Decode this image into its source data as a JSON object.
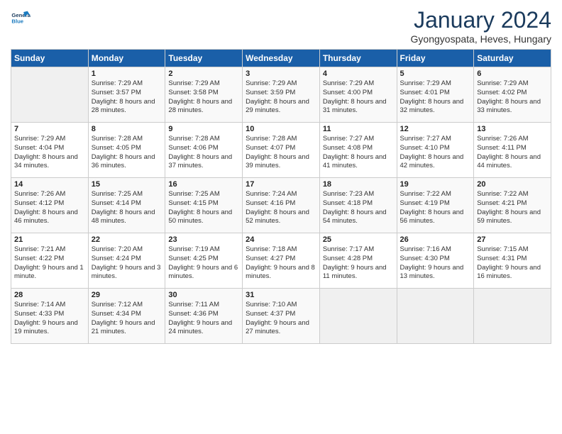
{
  "header": {
    "logo_general": "General",
    "logo_blue": "Blue",
    "month_title": "January 2024",
    "subtitle": "Gyongyospata, Heves, Hungary"
  },
  "days_of_week": [
    "Sunday",
    "Monday",
    "Tuesday",
    "Wednesday",
    "Thursday",
    "Friday",
    "Saturday"
  ],
  "weeks": [
    [
      {
        "day": "",
        "sunrise": "",
        "sunset": "",
        "daylight": ""
      },
      {
        "day": "1",
        "sunrise": "Sunrise: 7:29 AM",
        "sunset": "Sunset: 3:57 PM",
        "daylight": "Daylight: 8 hours and 28 minutes."
      },
      {
        "day": "2",
        "sunrise": "Sunrise: 7:29 AM",
        "sunset": "Sunset: 3:58 PM",
        "daylight": "Daylight: 8 hours and 28 minutes."
      },
      {
        "day": "3",
        "sunrise": "Sunrise: 7:29 AM",
        "sunset": "Sunset: 3:59 PM",
        "daylight": "Daylight: 8 hours and 29 minutes."
      },
      {
        "day": "4",
        "sunrise": "Sunrise: 7:29 AM",
        "sunset": "Sunset: 4:00 PM",
        "daylight": "Daylight: 8 hours and 31 minutes."
      },
      {
        "day": "5",
        "sunrise": "Sunrise: 7:29 AM",
        "sunset": "Sunset: 4:01 PM",
        "daylight": "Daylight: 8 hours and 32 minutes."
      },
      {
        "day": "6",
        "sunrise": "Sunrise: 7:29 AM",
        "sunset": "Sunset: 4:02 PM",
        "daylight": "Daylight: 8 hours and 33 minutes."
      }
    ],
    [
      {
        "day": "7",
        "sunrise": "Sunrise: 7:29 AM",
        "sunset": "Sunset: 4:04 PM",
        "daylight": "Daylight: 8 hours and 34 minutes."
      },
      {
        "day": "8",
        "sunrise": "Sunrise: 7:28 AM",
        "sunset": "Sunset: 4:05 PM",
        "daylight": "Daylight: 8 hours and 36 minutes."
      },
      {
        "day": "9",
        "sunrise": "Sunrise: 7:28 AM",
        "sunset": "Sunset: 4:06 PM",
        "daylight": "Daylight: 8 hours and 37 minutes."
      },
      {
        "day": "10",
        "sunrise": "Sunrise: 7:28 AM",
        "sunset": "Sunset: 4:07 PM",
        "daylight": "Daylight: 8 hours and 39 minutes."
      },
      {
        "day": "11",
        "sunrise": "Sunrise: 7:27 AM",
        "sunset": "Sunset: 4:08 PM",
        "daylight": "Daylight: 8 hours and 41 minutes."
      },
      {
        "day": "12",
        "sunrise": "Sunrise: 7:27 AM",
        "sunset": "Sunset: 4:10 PM",
        "daylight": "Daylight: 8 hours and 42 minutes."
      },
      {
        "day": "13",
        "sunrise": "Sunrise: 7:26 AM",
        "sunset": "Sunset: 4:11 PM",
        "daylight": "Daylight: 8 hours and 44 minutes."
      }
    ],
    [
      {
        "day": "14",
        "sunrise": "Sunrise: 7:26 AM",
        "sunset": "Sunset: 4:12 PM",
        "daylight": "Daylight: 8 hours and 46 minutes."
      },
      {
        "day": "15",
        "sunrise": "Sunrise: 7:25 AM",
        "sunset": "Sunset: 4:14 PM",
        "daylight": "Daylight: 8 hours and 48 minutes."
      },
      {
        "day": "16",
        "sunrise": "Sunrise: 7:25 AM",
        "sunset": "Sunset: 4:15 PM",
        "daylight": "Daylight: 8 hours and 50 minutes."
      },
      {
        "day": "17",
        "sunrise": "Sunrise: 7:24 AM",
        "sunset": "Sunset: 4:16 PM",
        "daylight": "Daylight: 8 hours and 52 minutes."
      },
      {
        "day": "18",
        "sunrise": "Sunrise: 7:23 AM",
        "sunset": "Sunset: 4:18 PM",
        "daylight": "Daylight: 8 hours and 54 minutes."
      },
      {
        "day": "19",
        "sunrise": "Sunrise: 7:22 AM",
        "sunset": "Sunset: 4:19 PM",
        "daylight": "Daylight: 8 hours and 56 minutes."
      },
      {
        "day": "20",
        "sunrise": "Sunrise: 7:22 AM",
        "sunset": "Sunset: 4:21 PM",
        "daylight": "Daylight: 8 hours and 59 minutes."
      }
    ],
    [
      {
        "day": "21",
        "sunrise": "Sunrise: 7:21 AM",
        "sunset": "Sunset: 4:22 PM",
        "daylight": "Daylight: 9 hours and 1 minute."
      },
      {
        "day": "22",
        "sunrise": "Sunrise: 7:20 AM",
        "sunset": "Sunset: 4:24 PM",
        "daylight": "Daylight: 9 hours and 3 minutes."
      },
      {
        "day": "23",
        "sunrise": "Sunrise: 7:19 AM",
        "sunset": "Sunset: 4:25 PM",
        "daylight": "Daylight: 9 hours and 6 minutes."
      },
      {
        "day": "24",
        "sunrise": "Sunrise: 7:18 AM",
        "sunset": "Sunset: 4:27 PM",
        "daylight": "Daylight: 9 hours and 8 minutes."
      },
      {
        "day": "25",
        "sunrise": "Sunrise: 7:17 AM",
        "sunset": "Sunset: 4:28 PM",
        "daylight": "Daylight: 9 hours and 11 minutes."
      },
      {
        "day": "26",
        "sunrise": "Sunrise: 7:16 AM",
        "sunset": "Sunset: 4:30 PM",
        "daylight": "Daylight: 9 hours and 13 minutes."
      },
      {
        "day": "27",
        "sunrise": "Sunrise: 7:15 AM",
        "sunset": "Sunset: 4:31 PM",
        "daylight": "Daylight: 9 hours and 16 minutes."
      }
    ],
    [
      {
        "day": "28",
        "sunrise": "Sunrise: 7:14 AM",
        "sunset": "Sunset: 4:33 PM",
        "daylight": "Daylight: 9 hours and 19 minutes."
      },
      {
        "day": "29",
        "sunrise": "Sunrise: 7:12 AM",
        "sunset": "Sunset: 4:34 PM",
        "daylight": "Daylight: 9 hours and 21 minutes."
      },
      {
        "day": "30",
        "sunrise": "Sunrise: 7:11 AM",
        "sunset": "Sunset: 4:36 PM",
        "daylight": "Daylight: 9 hours and 24 minutes."
      },
      {
        "day": "31",
        "sunrise": "Sunrise: 7:10 AM",
        "sunset": "Sunset: 4:37 PM",
        "daylight": "Daylight: 9 hours and 27 minutes."
      },
      {
        "day": "",
        "sunrise": "",
        "sunset": "",
        "daylight": ""
      },
      {
        "day": "",
        "sunrise": "",
        "sunset": "",
        "daylight": ""
      },
      {
        "day": "",
        "sunrise": "",
        "sunset": "",
        "daylight": ""
      }
    ]
  ]
}
